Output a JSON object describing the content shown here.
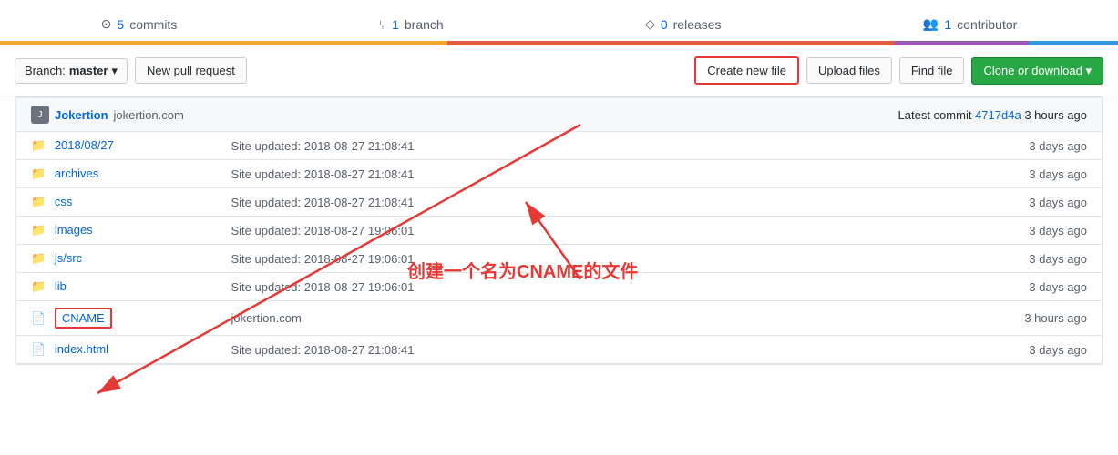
{
  "topBar": {
    "commits": {
      "icon": "⊙",
      "count": "5",
      "label": "commits"
    },
    "branch": {
      "icon": "ᚙ",
      "count": "1",
      "label": "branch"
    },
    "releases": {
      "icon": "◇",
      "count": "0",
      "label": "releases"
    },
    "contributors": {
      "icon": "👥",
      "count": "1",
      "label": "contributor"
    }
  },
  "toolbar": {
    "branch_label": "Branch:",
    "branch_name": "master",
    "new_pull_request": "New pull request",
    "create_new_file": "Create new file",
    "upload_files": "Upload files",
    "find_file": "Find file",
    "clone_or_download": "Clone or download ▾"
  },
  "repoHeader": {
    "user_avatar": "J",
    "username": "Jokertion",
    "domain": "jokertion.com",
    "latest_commit_prefix": "Latest commit",
    "commit_hash": "4717d4a",
    "time_ago": "3 hours ago"
  },
  "files": [
    {
      "type": "folder",
      "name": "2018/08/27",
      "commit_msg": "Site updated: 2018-08-27 21:08:41",
      "time": "3 days ago"
    },
    {
      "type": "folder",
      "name": "archives",
      "commit_msg": "Site updated: 2018-08-27 21:08:41",
      "time": "3 days ago"
    },
    {
      "type": "folder",
      "name": "css",
      "commit_msg": "Site updated: 2018-08-27 21:08:41",
      "time": "3 days ago"
    },
    {
      "type": "folder",
      "name": "images",
      "commit_msg": "Site updated: 2018-08-27 19:06:01",
      "time": "3 days ago"
    },
    {
      "type": "folder",
      "name": "js/src",
      "commit_msg": "Site updated: 2018-08-27 19:06:01",
      "time": "3 days ago"
    },
    {
      "type": "folder",
      "name": "lib",
      "commit_msg": "Site updated: 2018-08-27 19:06:01",
      "time": "3 days ago"
    },
    {
      "type": "file-highlight",
      "name": "CNAME",
      "commit_msg": "jokertion.com",
      "time": "3 hours ago"
    },
    {
      "type": "file",
      "name": "index.html",
      "commit_msg": "Site updated: 2018-08-27 21:08:41",
      "time": "3 days ago"
    }
  ],
  "annotation": {
    "chinese_text": "创建一个名为CNAME的文件"
  }
}
